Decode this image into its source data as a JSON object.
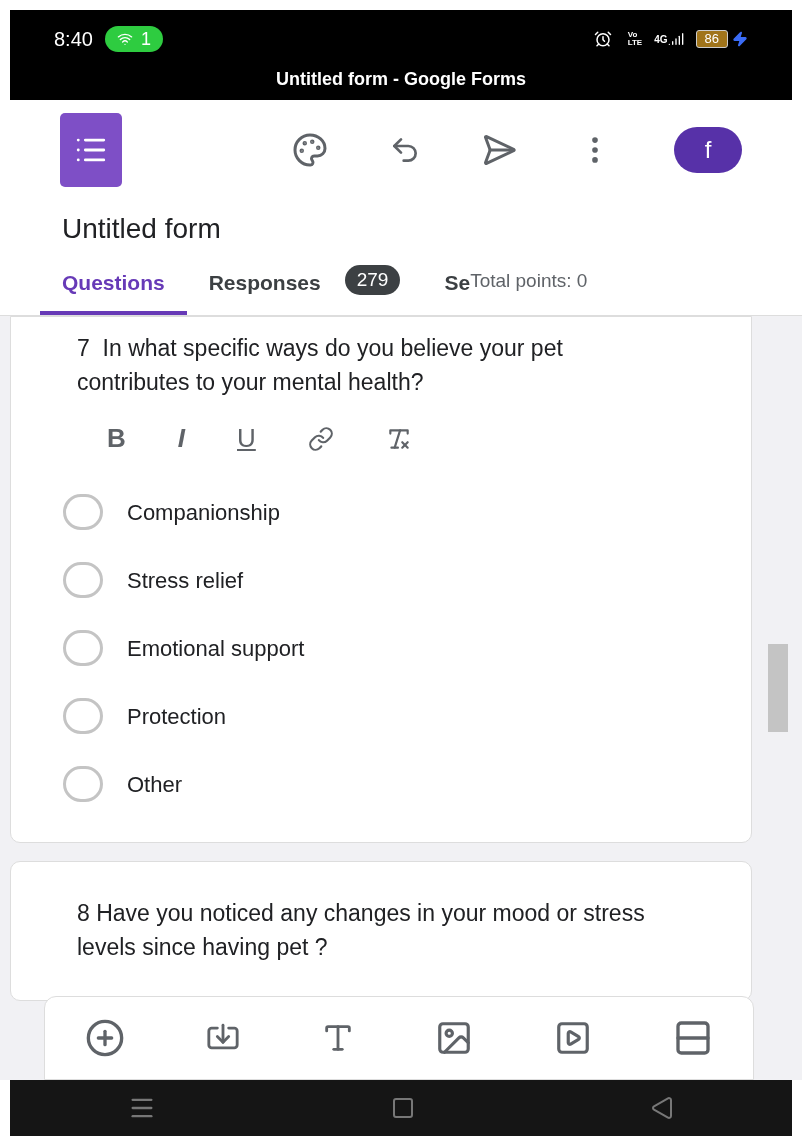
{
  "status_bar": {
    "time": "8:40",
    "hotspot_count": "1",
    "volte_top": "Vo",
    "volte_bottom": "LTE",
    "network": "4G",
    "battery": "86",
    "charging": true
  },
  "window": {
    "title": "Untitled form - Google Forms"
  },
  "form": {
    "title": "Untitled form"
  },
  "avatar": {
    "letter": "f"
  },
  "tabs": [
    {
      "label": "Questions",
      "selected": true
    },
    {
      "label": "Responses",
      "selected": false,
      "badge": "279"
    },
    {
      "label": "Se",
      "selected": false
    }
  ],
  "total_points": "Total points: 0",
  "questions": [
    {
      "number": "7",
      "text": "In what specific ways do you believe your pet contributes to your mental health?",
      "format_buttons": [
        "B",
        "I",
        "U"
      ],
      "options": [
        {
          "label": "Companionship",
          "selected": false
        },
        {
          "label": "Stress relief",
          "selected": false
        },
        {
          "label": "Emotional support",
          "selected": false
        },
        {
          "label": "Protection",
          "selected": false
        },
        {
          "label": "Other",
          "selected": false
        }
      ]
    },
    {
      "number": "8",
      "text": "Have you noticed any changes in your mood or stress levels since having pet ?"
    }
  ]
}
